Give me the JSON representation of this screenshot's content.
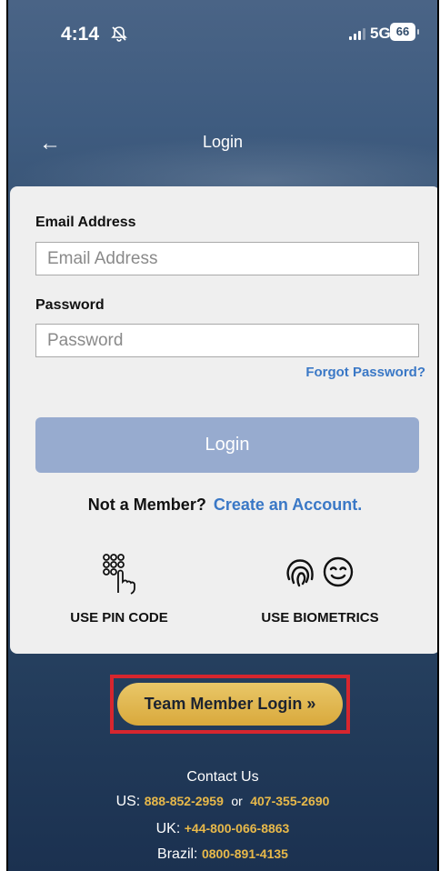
{
  "status_bar": {
    "time": "4:14",
    "network": "5G",
    "battery": "66"
  },
  "nav": {
    "title": "Login",
    "back_icon": "←"
  },
  "form": {
    "email_label": "Email Address",
    "email_placeholder": "Email Address",
    "password_label": "Password",
    "password_placeholder": "Password",
    "forgot_password": "Forgot Password?",
    "login_button": "Login",
    "not_member_text": "Not a Member?",
    "create_account_link": "Create an Account."
  },
  "alt_login": {
    "pin_label": "USE PIN CODE",
    "pin_icon": "keypad-tap-icon",
    "biometrics_label": "USE BIOMETRICS",
    "biometrics_icons": [
      "fingerprint-icon",
      "face-id-icon"
    ]
  },
  "team_member_button": "Team Member Login »",
  "contact": {
    "title": "Contact Us",
    "us_label": "US:",
    "us_phone_1": "888-852-2959",
    "or_text": "or",
    "us_phone_2": "407-355-2690",
    "uk_label": "UK:",
    "uk_phone": "+44-800-066-8863",
    "brazil_label": "Brazil:",
    "brazil_phone": "0800-891-4135"
  },
  "colors": {
    "link": "#3a78c6",
    "login_button": "#97abcf",
    "team_button": "#d9a93c",
    "highlight_border": "#d7262e",
    "phone_numbers": "#e8b94a"
  }
}
